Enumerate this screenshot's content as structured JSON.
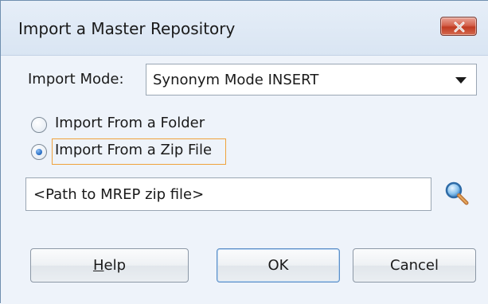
{
  "window": {
    "title": "Import a Master Repository"
  },
  "import_mode": {
    "label": "Import Mode:",
    "selected": "Synonym Mode INSERT"
  },
  "source": {
    "option_folder": "Import From a Folder",
    "option_zip": "Import From a Zip File",
    "selected": "Import From a Zip File"
  },
  "path_field": {
    "value": "<Path to MREP zip file>"
  },
  "buttons": {
    "help": "Help",
    "ok": "OK",
    "cancel": "Cancel"
  },
  "icons": {
    "close": "close-icon",
    "dropdown": "chevron-down-icon",
    "search": "search-icon"
  },
  "colors": {
    "close_button": "#d4624c",
    "focus_outline": "#f0a23c",
    "radio_selected": "#2f74c9"
  }
}
